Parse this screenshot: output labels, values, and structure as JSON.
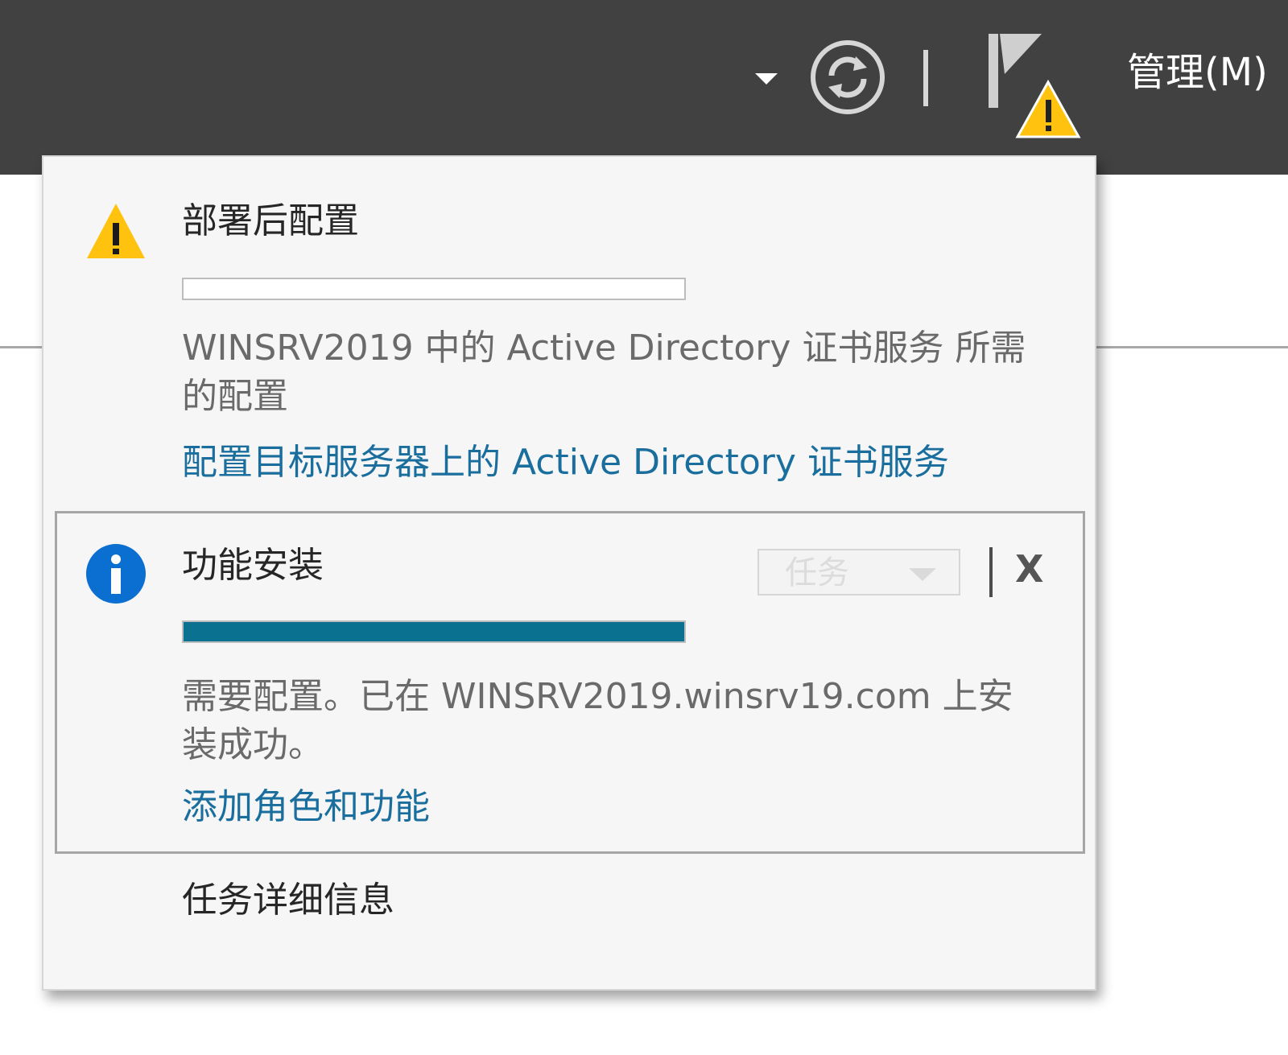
{
  "top_bar": {
    "background": "#414141",
    "icons": {
      "dropdown": "caret-down-icon",
      "refresh": "refresh-icon",
      "notifications": "flag-warning-icon"
    },
    "manage_label": "管理(M)"
  },
  "notifications": [
    {
      "icon": "warning-icon",
      "title": "部署后配置",
      "progress": 0,
      "description": "WINSRV2019 中的 Active Directory 证书服务 所需的配置",
      "link": "配置目标服务器上的 Active Directory 证书服务"
    },
    {
      "icon": "info-icon",
      "title": "功能安装",
      "progress": 1,
      "task_label": "任务",
      "close_label": "X",
      "description": "需要配置。已在 WINSRV2019.winsrv19.com 上安装成功。",
      "link": "添加角色和功能"
    }
  ],
  "footer": {
    "task_details": "任务详细信息"
  },
  "colors": {
    "accent_link": "#1a6e9d",
    "progress_fill": "#0a7191",
    "warning": "#ffc20e",
    "info": "#0a6fd0"
  }
}
